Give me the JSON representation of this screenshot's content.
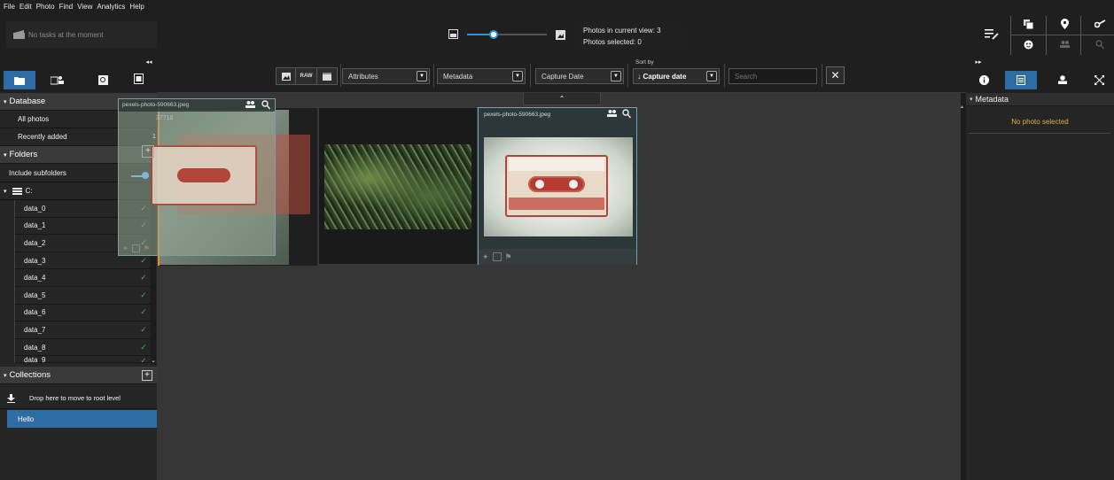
{
  "menu": [
    "File",
    "Edit",
    "Photo",
    "Find",
    "View",
    "Analytics",
    "Help"
  ],
  "tasks_text": "No tasks at the moment",
  "zoom": {
    "level": 0.33
  },
  "stats": {
    "in_view": "Photos in current view: 3",
    "selected": "Photos selected: 0"
  },
  "sidebar": {
    "database_header": "Database",
    "all_photos": "All photos",
    "recently_added": "Recently added",
    "folders_header": "Folders",
    "include_subfolders": "Include subfolders",
    "drive": "C:",
    "folders": [
      "data_0",
      "data_1",
      "data_2",
      "data_3",
      "data_4",
      "data_5",
      "data_6",
      "data_7",
      "data_8",
      "data_9"
    ],
    "collections_header": "Collections",
    "drop_hint": "Drop here to move to root level",
    "collection_items": [
      "Hello"
    ]
  },
  "toolbar": {
    "raw_label": "RAW",
    "attributes": "Attributes",
    "metadata": "Metadata",
    "capture_date": "Capture Date",
    "sort_by": "Sort by",
    "sort_value": "Capture date",
    "search_placeholder": "Search"
  },
  "photos": [
    {
      "name": "pexels-photo-590663.jpeg",
      "count": "37718",
      "badge": "1"
    },
    {
      "name": "",
      "count": "",
      "badge": ""
    },
    {
      "name": "pexels-photo-590663.jpeg",
      "count": "",
      "badge": ""
    }
  ],
  "right_panel": {
    "header": "Metadata",
    "empty_text": "No photo selected"
  },
  "colors": {
    "accent": "#2e6da4",
    "no_photo": "#e0b04a",
    "check": "#4caf50",
    "marker": "#f08a24"
  }
}
